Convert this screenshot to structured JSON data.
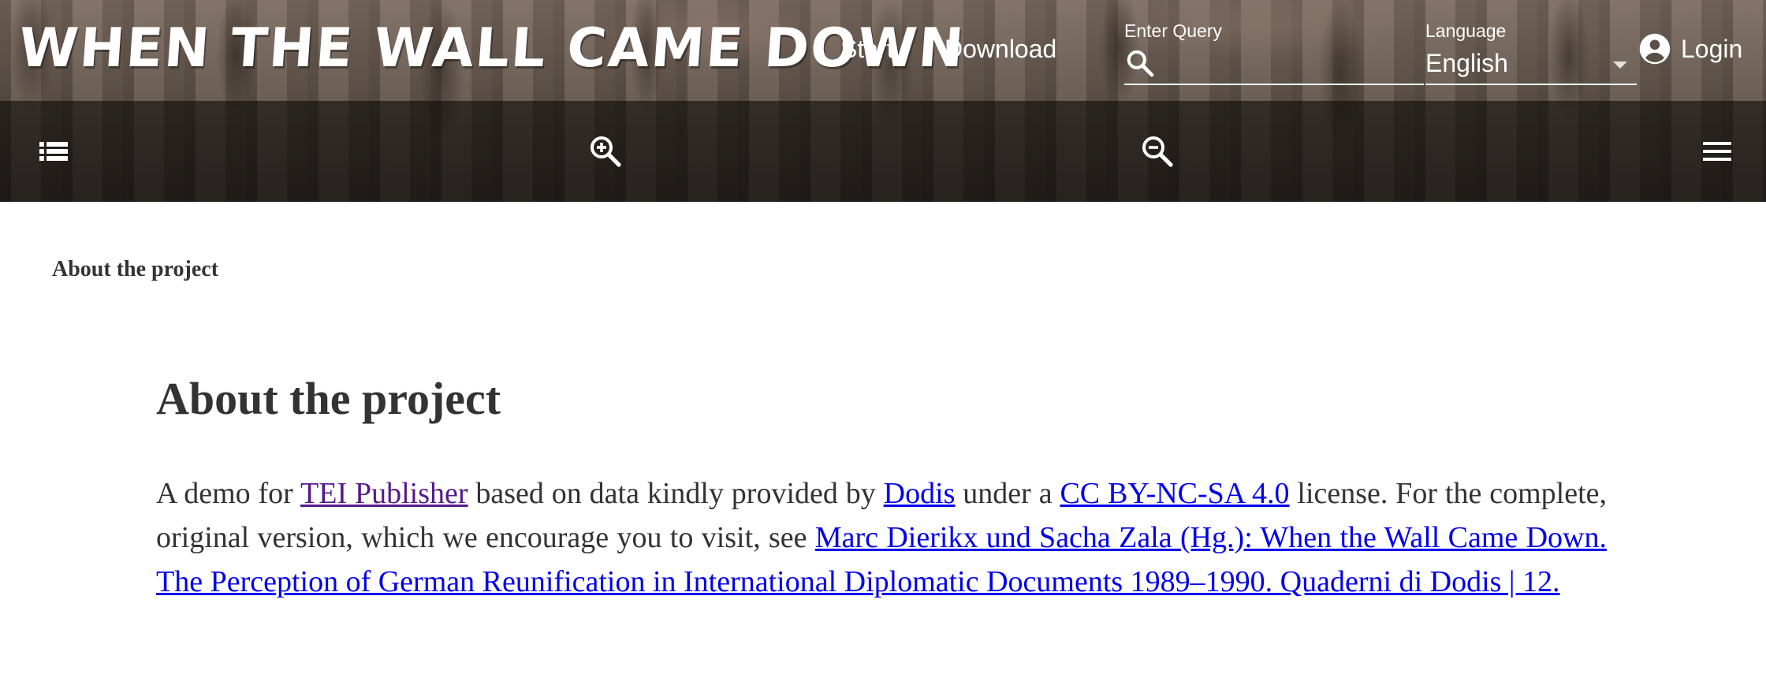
{
  "header": {
    "logo_text": "WHEN THE WALL CAME DOWN",
    "nav": {
      "start_label": "Start",
      "download_label": "Download"
    },
    "search": {
      "label": "Enter Query",
      "value": "",
      "icon": "search-icon"
    },
    "language": {
      "label": "Language",
      "selected": "English"
    },
    "login": {
      "label": "Login",
      "icon": "account-circle-icon"
    },
    "toolbar": {
      "toc_icon": "toc-list-icon",
      "zoom_in_icon": "zoom-in-icon",
      "zoom_out_icon": "zoom-out-icon",
      "menu_icon": "hamburger-menu-icon"
    }
  },
  "breadcrumb": {
    "label": "About the project"
  },
  "main": {
    "title": "About the project",
    "paragraph": {
      "text_1": "A demo for ",
      "link_tei": "TEI Publisher",
      "text_2": " based on data kindly provided by ",
      "link_dodis": "Dodis",
      "text_3": " under a ",
      "link_license": "CC BY-NC-SA 4.0",
      "text_4": " license. For the complete, original version, which we encourage you to visit, see ",
      "link_source": "Marc Dierikx und Sacha Zala (Hg.): When the Wall Came Down. The Perception of German Reunification in International Diplomatic Documents 1989–1990. Quaderni di Dodis | 12."
    }
  },
  "colors": {
    "link": "#0000ee",
    "visited_link": "#551a8b",
    "text": "#333333",
    "toolbar_overlay": "rgba(0,0,0,0.52)"
  }
}
